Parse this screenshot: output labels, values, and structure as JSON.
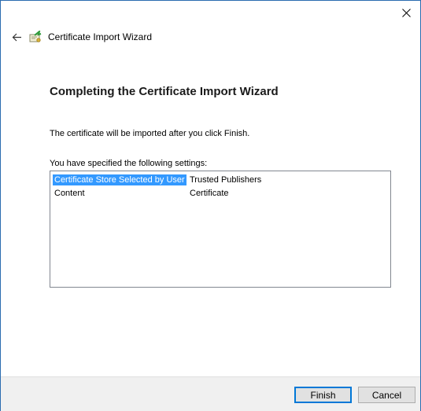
{
  "window": {
    "title": "Certificate Import Wizard",
    "close_label": "×",
    "back_icon": "back-arrow-icon",
    "app_icon": "certificate-icon"
  },
  "content": {
    "heading": "Completing the Certificate Import Wizard",
    "description": "The certificate will be imported after you click Finish.",
    "settings_label": "You have specified the following settings:",
    "settings": [
      {
        "key": "Certificate Store Selected by User",
        "value": "Trusted Publishers",
        "selected": true
      },
      {
        "key": "Content",
        "value": "Certificate",
        "selected": false
      }
    ]
  },
  "footer": {
    "finish_label": "Finish",
    "cancel_label": "Cancel"
  },
  "colors": {
    "accent": "#0078d7",
    "selection": "#3399ff"
  }
}
